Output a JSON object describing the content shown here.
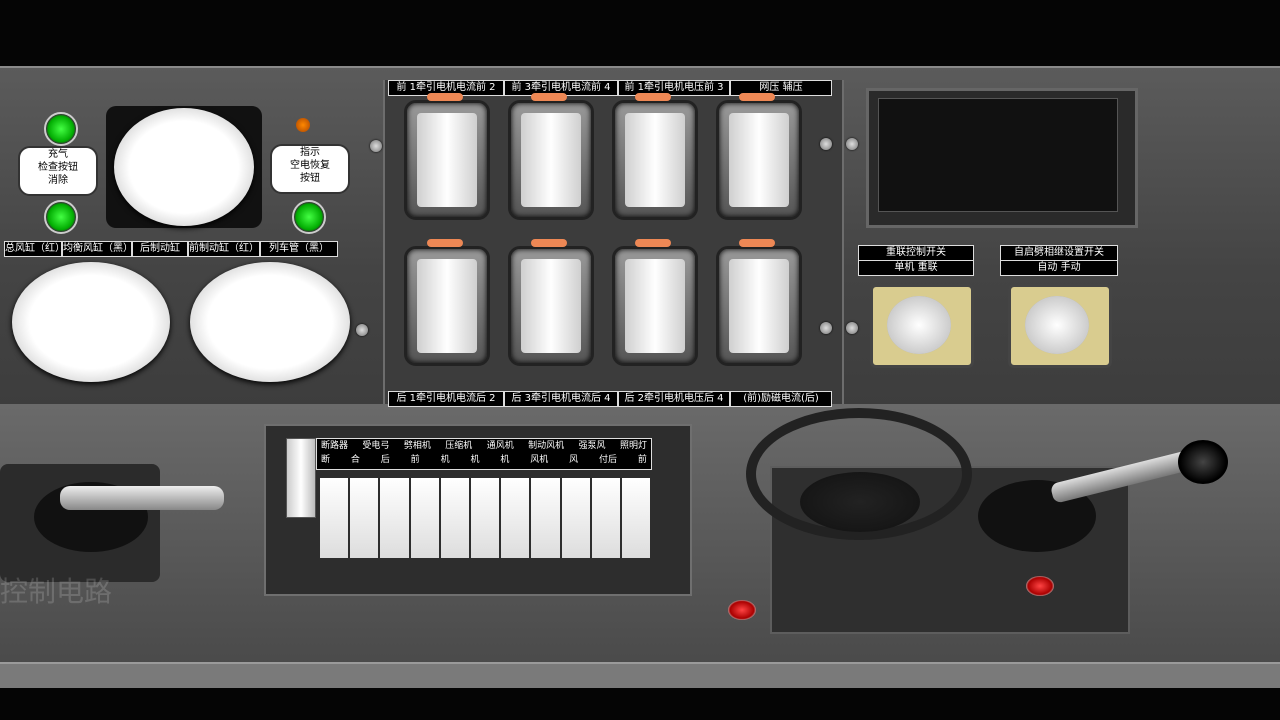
{
  "left_panel": {
    "left_badge": [
      "充气",
      "检查按钮",
      "消除"
    ],
    "right_badge": [
      "指示",
      "空电恢复",
      "按钮"
    ],
    "label_row": [
      "总风缸（红）",
      "均衡风缸（黑）",
      "后制动缸",
      "前制动缸（红）",
      "列车管（黑）"
    ]
  },
  "meters": {
    "top_labels": [
      "前 1牵引电机电流前 2",
      "前 3牵引电机电流前 4",
      "前 1牵引电机电压前 3",
      "网压    辅压"
    ],
    "bottom_labels": [
      "后 1牵引电机电流后 2",
      "后 3牵引电机电流后 4",
      "后 2牵引电机电压后 4",
      "(前)励磁电流(后)"
    ],
    "scale_values": [
      "1500",
      "1000",
      "500",
      "0"
    ]
  },
  "right_panel": {
    "switch_1_title": "重联控制开关",
    "switch_1_options": "单机  重联",
    "switch_2_title": "自启劈相继设置开关",
    "switch_2_options": "自动  手动"
  },
  "switch_panel": {
    "labels_top": [
      "断路器",
      "受电弓",
      "劈相机",
      "压缩机",
      "通风机",
      "制动风机",
      "强泵风",
      "照明灯"
    ],
    "labels_bottom": [
      "断",
      "合",
      "后",
      "前",
      "机",
      "机",
      "机",
      "风机",
      "风",
      "付后",
      "前"
    ]
  },
  "left_bottom": {
    "watermark": "控制电路"
  },
  "colors": {
    "accent_red": "#cc0000",
    "lamp_green": "#1fd11f"
  }
}
